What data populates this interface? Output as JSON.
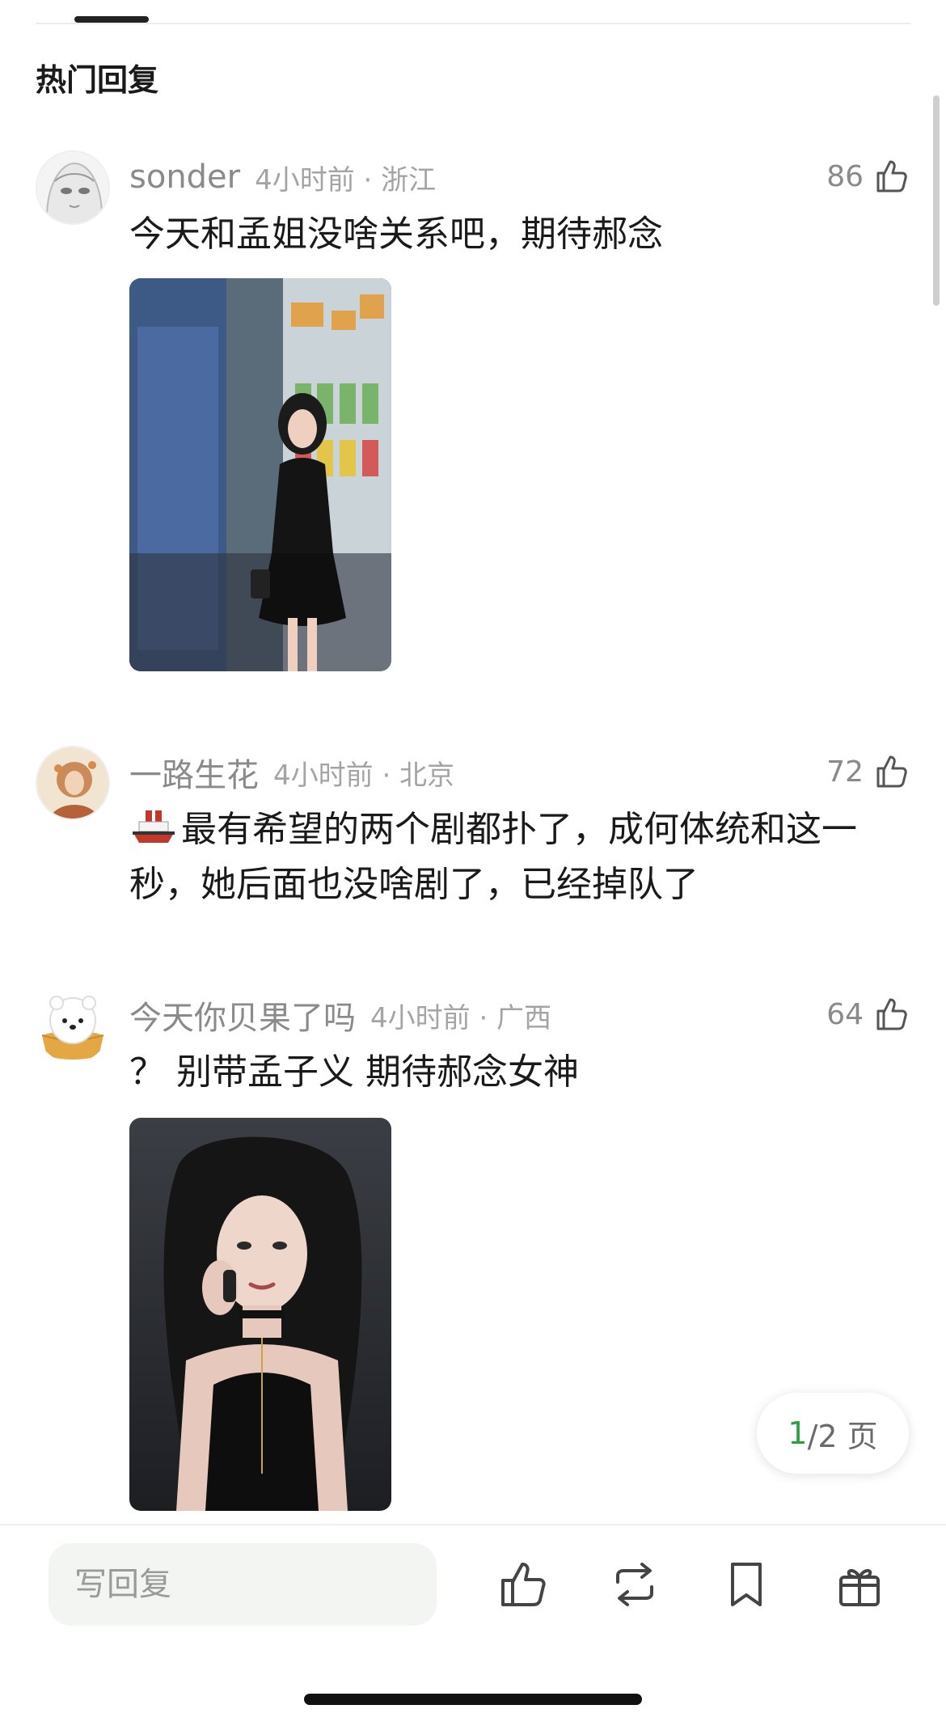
{
  "section": {
    "title": "热门回复"
  },
  "comments": [
    {
      "username": "sonder",
      "meta": "4小时前 · 浙江",
      "likes": "86",
      "text": "今天和孟姐没啥关系吧，期待郝念",
      "avatar_icon": "anime-girl-avatar",
      "image_desc": "woman-in-black-dress-convenience-store"
    },
    {
      "username": "一路生花",
      "meta": "4小时前 · 北京",
      "likes": "72",
      "text": "最有希望的两个剧都扑了，成何体统和这一秒，她后面也没啥剧了，已经掉队了",
      "emoji_icon": "ship-emoji",
      "avatar_icon": "painting-avatar"
    },
    {
      "username": "今天你贝果了吗",
      "meta": "4小时前 · 广西",
      "likes": "64",
      "text": "？ 别带孟子义 期待郝念女神",
      "avatar_icon": "bear-bun-avatar",
      "image_desc": "woman-on-phone-portrait"
    }
  ],
  "pager": {
    "current": "1",
    "rest": "/2 页"
  },
  "bottom_bar": {
    "reply_placeholder": "写回复",
    "icons": [
      "like-icon",
      "repost-icon",
      "bookmark-icon",
      "gift-icon"
    ]
  },
  "colors": {
    "accent": "#2aa13f",
    "meta": "#a4a4a4",
    "username": "#8a8a8a"
  }
}
